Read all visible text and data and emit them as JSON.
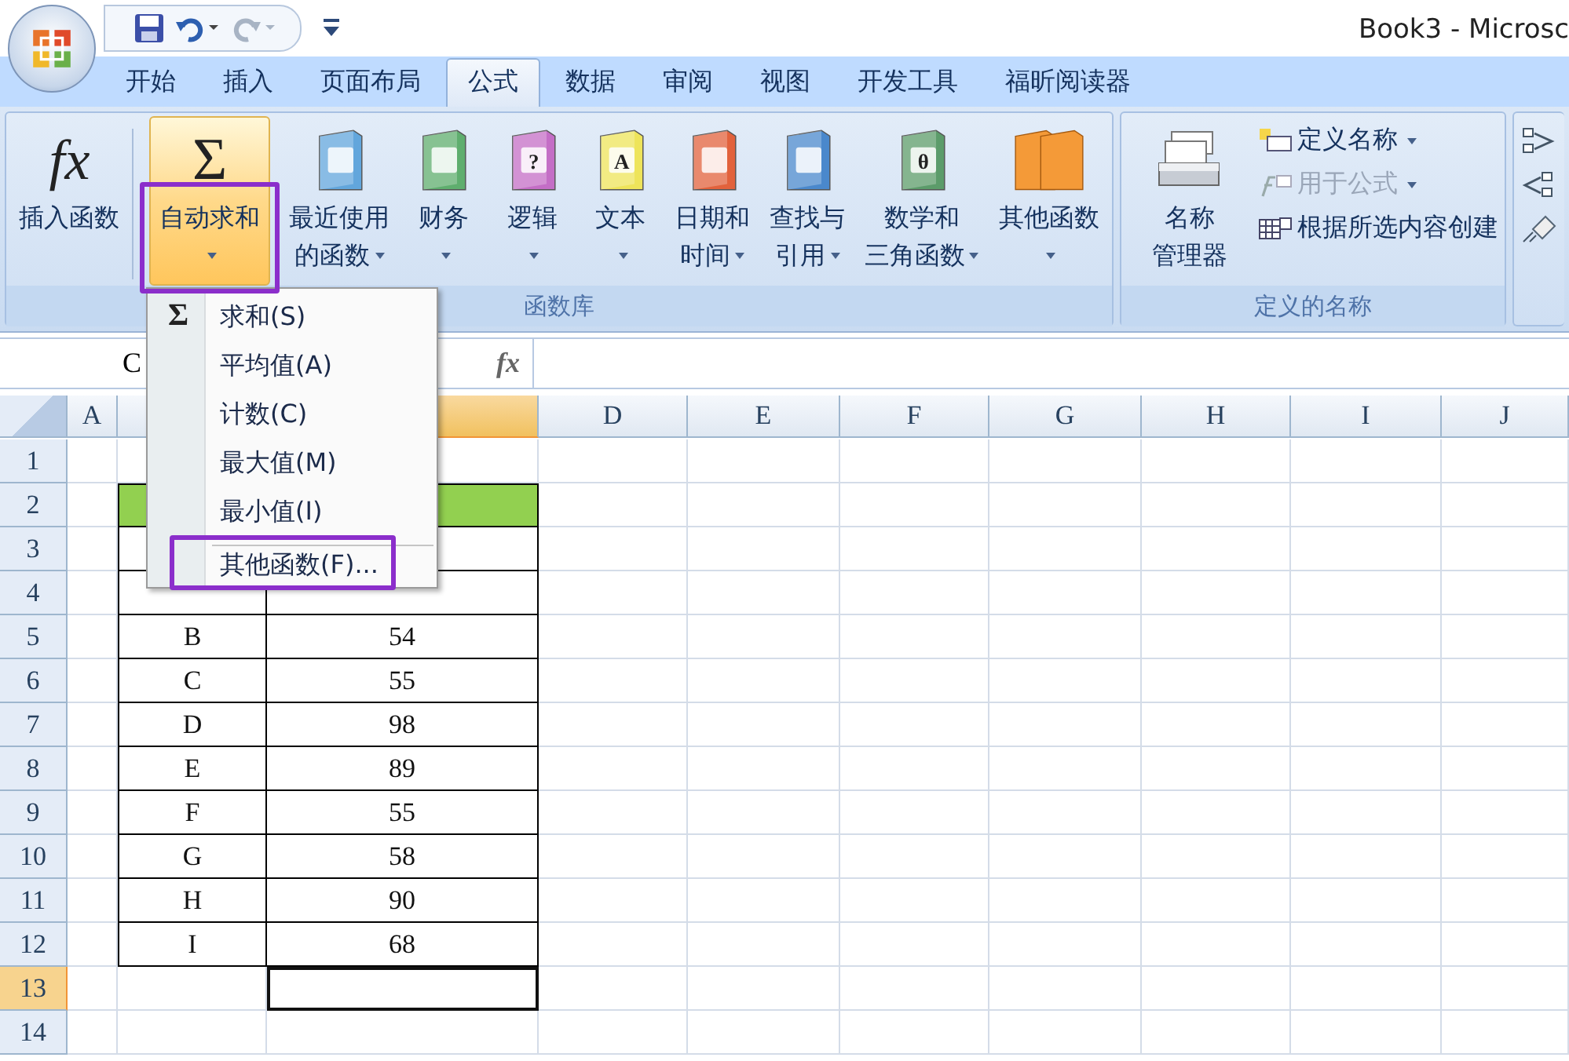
{
  "title": "Book3 - Microsc",
  "quick_access": [
    {
      "kind": "save",
      "disabled": false
    },
    {
      "kind": "undo",
      "disabled": false
    },
    {
      "kind": "redo",
      "disabled": true
    }
  ],
  "tabs": [
    {
      "label": "开始",
      "selected": false
    },
    {
      "label": "插入",
      "selected": false
    },
    {
      "label": "页面布局",
      "selected": false
    },
    {
      "label": "公式",
      "selected": true
    },
    {
      "label": "数据",
      "selected": false
    },
    {
      "label": "审阅",
      "selected": false
    },
    {
      "label": "视图",
      "selected": false
    },
    {
      "label": "开发工具",
      "selected": false
    },
    {
      "label": "福昕阅读器",
      "selected": false
    }
  ],
  "groups": [
    {
      "kind": "library",
      "label": "函数库",
      "buttons": [
        {
          "kind": "symbol",
          "symbol": "fx",
          "lines": [
            "插入函数"
          ],
          "dropdown": false,
          "selected": false,
          "annotated": false,
          "separator_after": true
        },
        {
          "kind": "symbol",
          "symbol": "Σ",
          "lines": [
            "自动求和"
          ],
          "dropdown": true,
          "selected": true,
          "annotated": true,
          "separator_after": false
        },
        {
          "kind": "book",
          "color": "#62a6dc",
          "lines": [
            "最近使用",
            "的函数"
          ],
          "dropdown": true,
          "selected": false,
          "annotated": false,
          "separator_after": false
        },
        {
          "kind": "book",
          "color": "#5fae6e",
          "lines": [
            "财务"
          ],
          "dropdown": true,
          "selected": false,
          "annotated": false,
          "separator_after": false
        },
        {
          "kind": "book",
          "color": "#c46ec6",
          "symbol": "?",
          "lines": [
            "逻辑"
          ],
          "dropdown": true,
          "selected": false,
          "annotated": false,
          "separator_after": false
        },
        {
          "kind": "book",
          "color": "#eee45a",
          "symbol": "A",
          "lines": [
            "文本"
          ],
          "dropdown": true,
          "selected": false,
          "annotated": false,
          "separator_after": false
        },
        {
          "kind": "book",
          "color": "#e2623c",
          "lines": [
            "日期和",
            "时间"
          ],
          "dropdown": true,
          "selected": false,
          "annotated": false,
          "separator_after": false
        },
        {
          "kind": "book",
          "color": "#4a88cc",
          "lines": [
            "查找与",
            "引用"
          ],
          "dropdown": true,
          "selected": false,
          "annotated": false,
          "separator_after": false
        },
        {
          "kind": "book",
          "color": "#5c9c6a",
          "symbol": "θ",
          "lines": [
            "数学和",
            "三角函数"
          ],
          "dropdown": true,
          "selected": false,
          "annotated": false,
          "separator_after": false
        },
        {
          "kind": "books",
          "color": "#f49a38",
          "lines": [
            "其他函数"
          ],
          "dropdown": true,
          "selected": false,
          "annotated": false,
          "separator_after": false
        }
      ]
    },
    {
      "kind": "names",
      "label": "定义的名称",
      "buttons": [
        {
          "kind": "cabinet",
          "lines": [
            "名称",
            "管理器"
          ],
          "dropdown": false,
          "selected": false,
          "annotated": false,
          "separator_after": false
        }
      ],
      "small_items": [
        {
          "kind": "define",
          "label": "定义名称",
          "dropdown": true,
          "disabled": false
        },
        {
          "kind": "formula",
          "label": "用于公式",
          "dropdown": true,
          "disabled": true
        },
        {
          "kind": "create",
          "label": "根据所选内容创建",
          "dropdown": false,
          "disabled": false
        }
      ]
    },
    {
      "kind": "audit"
    }
  ],
  "menu": {
    "items": [
      {
        "label": "求和(S)",
        "symbol": "Σ",
        "separator_before": false,
        "annotated": false
      },
      {
        "label": "平均值(A)",
        "separator_before": false,
        "annotated": false
      },
      {
        "label": "计数(C)",
        "separator_before": false,
        "annotated": false
      },
      {
        "label": "最大值(M)",
        "separator_before": false,
        "annotated": false
      },
      {
        "label": "最小值(I)",
        "separator_before": false,
        "annotated": false
      },
      {
        "label": "其他函数(F)...",
        "separator_before": true,
        "annotated": true
      }
    ]
  },
  "formula_bar": {
    "name_box": "C",
    "symbol": "fx"
  },
  "sheet": {
    "columns": [
      {
        "label": "A",
        "selected": false
      },
      {
        "selected": false
      },
      {
        "selected": true
      },
      {
        "label": "D",
        "selected": false
      },
      {
        "label": "E",
        "selected": false
      },
      {
        "label": "F",
        "selected": false
      },
      {
        "label": "G",
        "selected": false
      },
      {
        "label": "H",
        "selected": false
      },
      {
        "label": "I",
        "selected": false
      },
      {
        "label": "J",
        "selected": false
      }
    ],
    "rows": [
      {
        "header": "1",
        "kind": "plain",
        "selected": false
      },
      {
        "header": "2",
        "kind": "table_head",
        "selected": false
      },
      {
        "header": "3",
        "kind": "table",
        "selected": false
      },
      {
        "header": "4",
        "kind": "table",
        "selected": false
      },
      {
        "header": "5",
        "kind": "table",
        "selected": false,
        "b": "B",
        "c": "54"
      },
      {
        "header": "6",
        "kind": "table",
        "selected": false,
        "b": "C",
        "c": "55"
      },
      {
        "header": "7",
        "kind": "table",
        "selected": false,
        "b": "D",
        "c": "98"
      },
      {
        "header": "8",
        "kind": "table",
        "selected": false,
        "b": "E",
        "c": "89"
      },
      {
        "header": "9",
        "kind": "table",
        "selected": false,
        "b": "F",
        "c": "55"
      },
      {
        "header": "10",
        "kind": "table",
        "selected": false,
        "b": "G",
        "c": "58"
      },
      {
        "header": "11",
        "kind": "table",
        "selected": false,
        "b": "H",
        "c": "90"
      },
      {
        "header": "12",
        "kind": "table",
        "selected": false,
        "b": "I",
        "c": "68"
      },
      {
        "header": "13",
        "kind": "plain",
        "selected": true
      },
      {
        "header": "14",
        "kind": "plain",
        "selected": false
      }
    ]
  }
}
